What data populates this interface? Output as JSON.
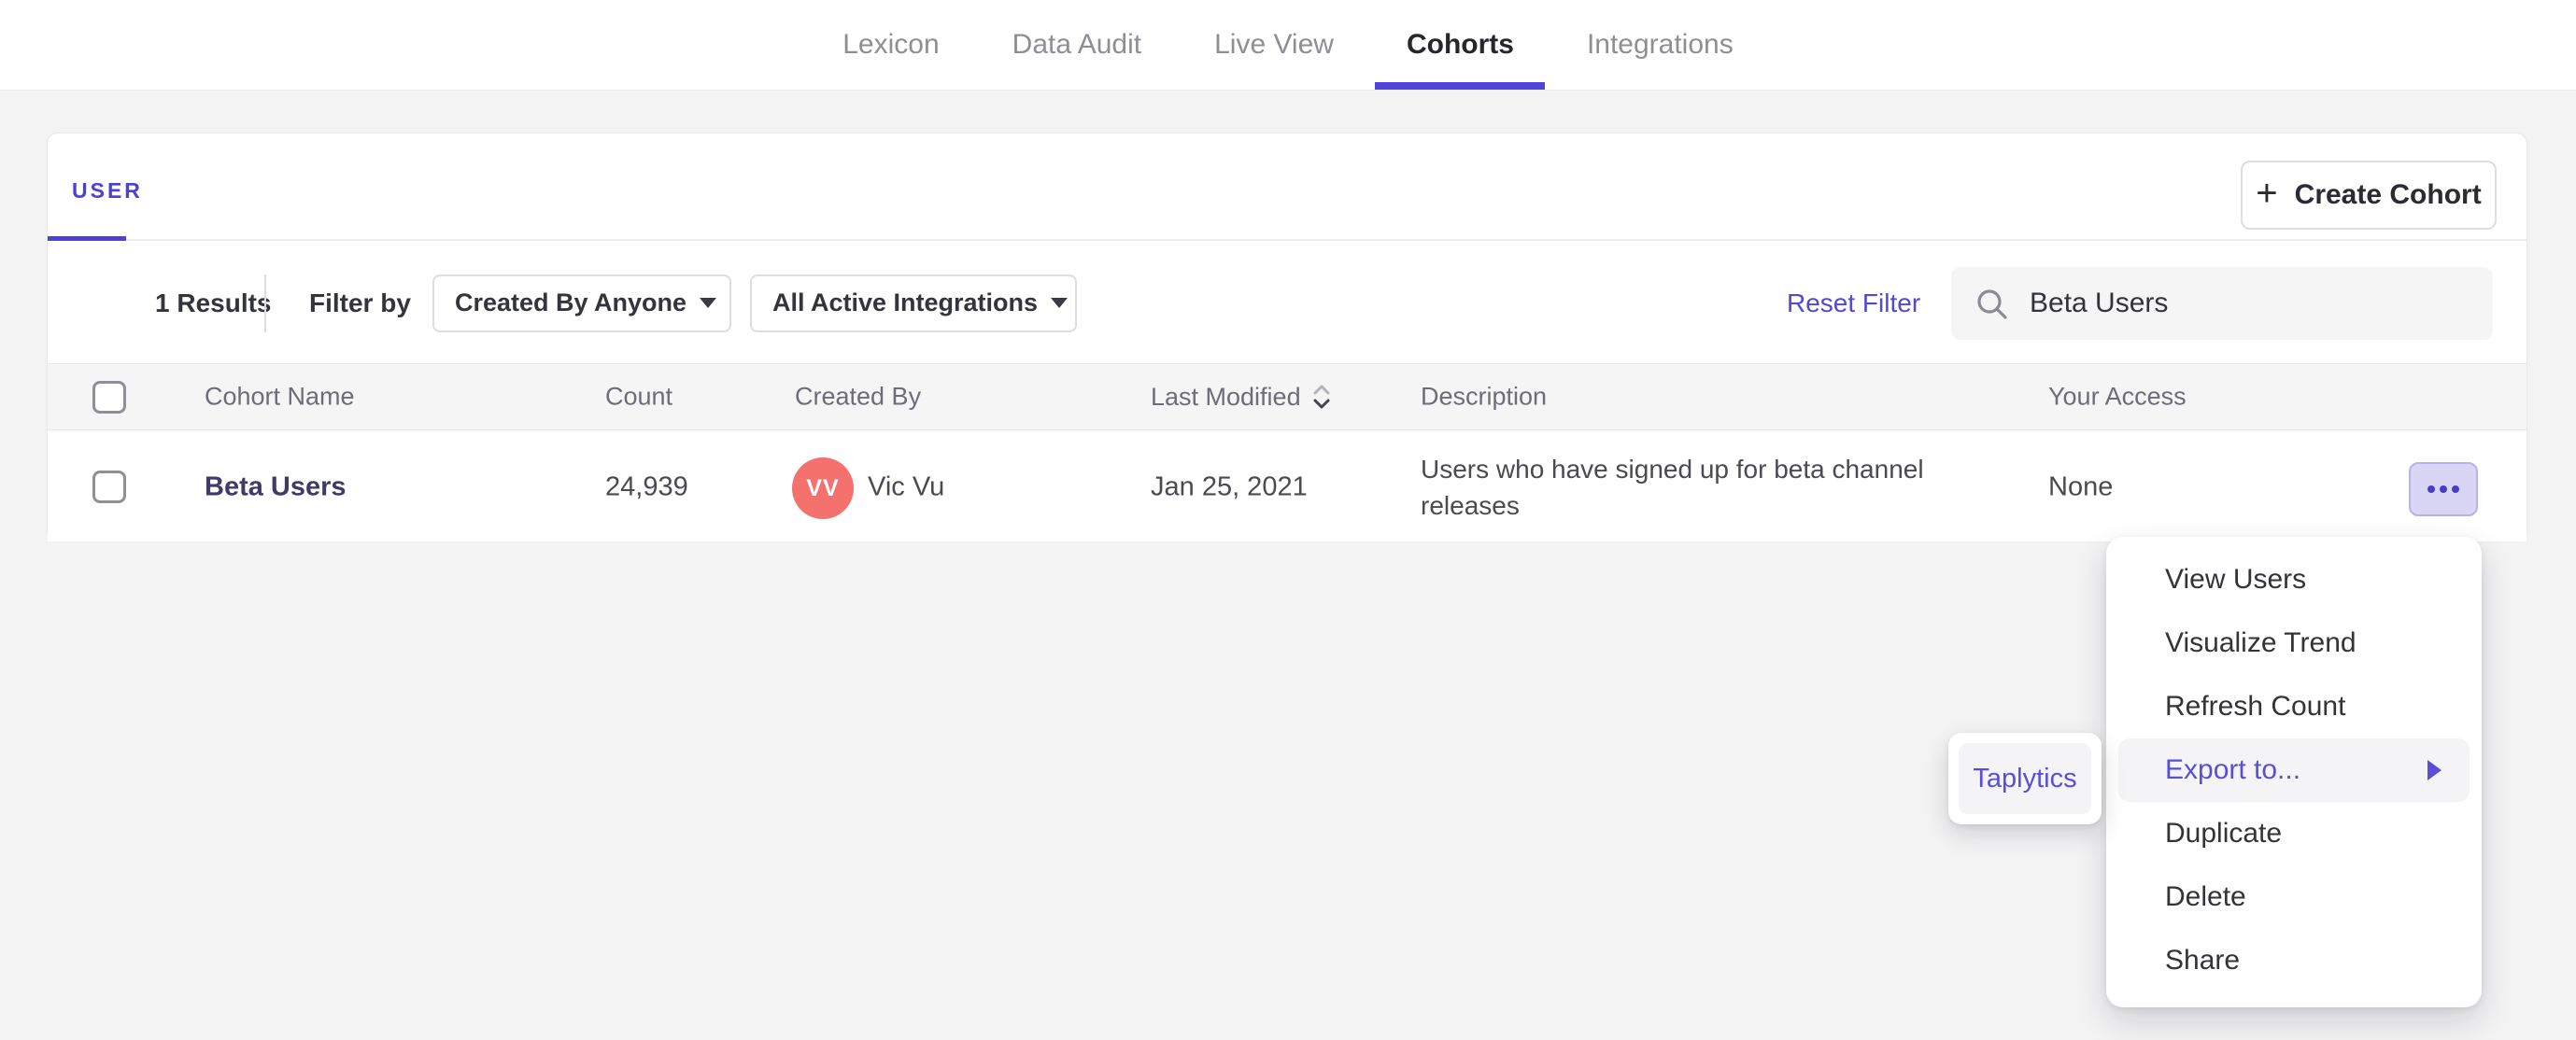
{
  "colors": {
    "accent_purple": "#4f43d9",
    "link_purple": "#5347d6",
    "menu_highlight_purple": "#5a4ed8",
    "avatar_red": "#f4716e",
    "more_button_bg": "#d9d5f4",
    "page_bg": "#f3f3f4",
    "table_header_bg": "#f5f5f6",
    "highlight_bg": "#f4f4f6",
    "cohort_link_color": "#3f3b68"
  },
  "nav": {
    "items": [
      {
        "label": "Lexicon",
        "active": false
      },
      {
        "label": "Data Audit",
        "active": false
      },
      {
        "label": "Live View",
        "active": false
      },
      {
        "label": "Cohorts",
        "active": true
      },
      {
        "label": "Integrations",
        "active": false
      }
    ]
  },
  "card": {
    "tab_label": "USER",
    "create_button": {
      "plus": "+",
      "label": "Create Cohort"
    },
    "filters": {
      "results": "1 Results",
      "filter_by_label": "Filter by",
      "created_by_dropdown": "Created By Anyone",
      "integrations_dropdown": "All Active Integrations",
      "reset_label": "Reset Filter",
      "search_value": "Beta Users"
    },
    "table": {
      "headers": {
        "cohort_name": "Cohort Name",
        "count": "Count",
        "created_by": "Created By",
        "last_modified": "Last Modified",
        "description": "Description",
        "your_access": "Your Access"
      },
      "row": {
        "name": "Beta Users",
        "count": "24,939",
        "avatar_initials": "VV",
        "created_by": "Vic Vu",
        "last_modified": "Jan 25, 2021",
        "description": "Users who have signed up for beta channel releases",
        "access": "None"
      }
    }
  },
  "context_menu": {
    "items": [
      "View Users",
      "Visualize Trend",
      "Refresh Count",
      "Export to...",
      "Duplicate",
      "Delete",
      "Share"
    ],
    "highlighted_item": "Export to..."
  },
  "export_submenu": {
    "items": [
      "Taplytics"
    ]
  }
}
